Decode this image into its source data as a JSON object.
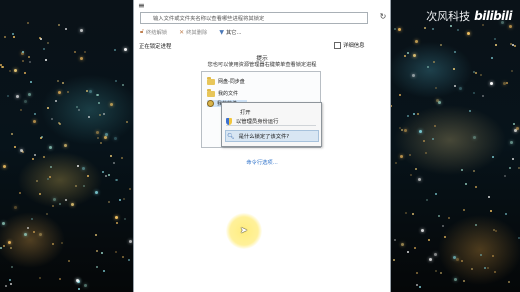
{
  "watermark": {
    "channel": "次风科技",
    "logo": "bilibili"
  },
  "app": {
    "search": {
      "placeholder": "输入文件或文件夹名称以查看哪些进程将其锁定"
    },
    "toolbar": {
      "terminate": "终结解锁",
      "force_delete": "终其删除",
      "other": "其它..."
    },
    "status": "正在锁定进程",
    "detail_label": "详细信息",
    "hint": {
      "title": "提示",
      "description": "您也可以使用资源管理器右键菜单查看锁定进程"
    },
    "explorer": {
      "items": [
        "网盘-同步盘",
        "我的文件",
        "我的软件"
      ]
    },
    "context_menu": {
      "items": [
        "打开",
        "以管理员身份运行",
        "是什么锁定了该文件?"
      ]
    },
    "cmdline_link": "命令行选项..."
  },
  "colors": {
    "link": "#2a6fc9",
    "highlight": "#ffec78",
    "selection": "#cfe3f6"
  }
}
